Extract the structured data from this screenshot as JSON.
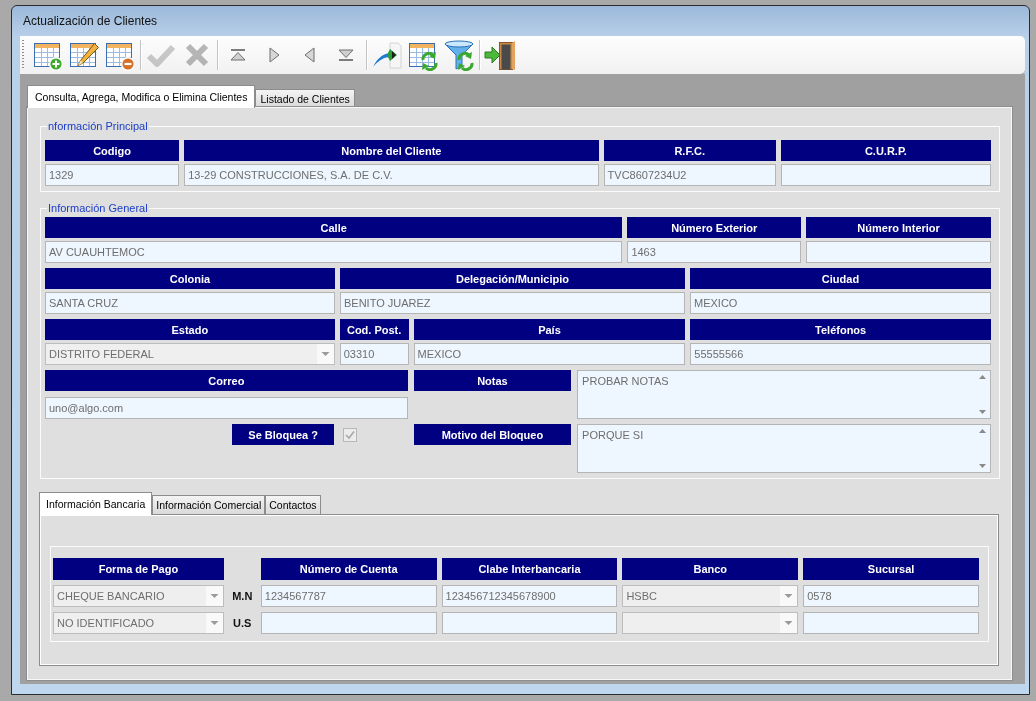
{
  "window": {
    "title": "Actualización de Clientes"
  },
  "toolbar": {
    "groups": [
      {
        "buttons": [
          {
            "kind": "add",
            "disabled": false
          },
          {
            "kind": "edit",
            "disabled": false
          },
          {
            "kind": "delete",
            "disabled": false
          }
        ]
      },
      {
        "buttons": [
          {
            "kind": "accept",
            "disabled": true
          },
          {
            "kind": "cancel",
            "disabled": true
          }
        ]
      },
      {
        "buttons": [
          {
            "kind": "first",
            "disabled": false
          },
          {
            "kind": "next",
            "disabled": false
          },
          {
            "kind": "previous",
            "disabled": false
          },
          {
            "kind": "last",
            "disabled": false
          }
        ]
      },
      {
        "buttons": [
          {
            "kind": "export",
            "disabled": false
          },
          {
            "kind": "refresh",
            "disabled": false
          },
          {
            "kind": "filter",
            "disabled": false
          }
        ]
      },
      {
        "buttons": [
          {
            "kind": "exit",
            "disabled": false
          }
        ]
      }
    ]
  },
  "tabs": [
    {
      "label": "Consulta, Agrega, Modifica o Elimina Clientes",
      "selected": true
    },
    {
      "label": "Listado de Clientes",
      "selected": false
    }
  ],
  "principal": {
    "legend": "nformación Principal",
    "fields": [
      {
        "label": "Codigo",
        "kind": "text",
        "value": "1329"
      },
      {
        "label": "Nombre del Cliente",
        "kind": "text",
        "value": "13-29 CONSTRUCCIONES, S.A. DE C.V."
      },
      {
        "label": "R.F.C.",
        "kind": "text",
        "value": "TVC8607234U2"
      },
      {
        "label": "C.U.R.P.",
        "kind": "text"
      }
    ]
  },
  "general": {
    "legend": "Información General",
    "rows": [
      {
        "fields": [
          {
            "label": "Calle",
            "kind": "text",
            "value": "AV CUAUHTEMOC"
          },
          {
            "label": "Número Exterior",
            "kind": "text",
            "value": "1463"
          },
          {
            "label": "Número Interior",
            "kind": "text"
          }
        ]
      },
      {
        "fields": [
          {
            "label": "Colonia",
            "kind": "text",
            "value": "SANTA CRUZ"
          },
          {
            "label": "Delegación/Municipio",
            "kind": "text",
            "value": "BENITO JUAREZ"
          },
          {
            "label": "Ciudad",
            "kind": "text",
            "value": "MEXICO"
          }
        ]
      },
      {
        "fields": [
          {
            "label": "Estado",
            "kind": "combo",
            "value": "DISTRITO FEDERAL"
          },
          {
            "label": "Cod. Post.",
            "kind": "text",
            "value": "03310"
          },
          {
            "label": "País",
            "kind": "text",
            "value": "MEXICO"
          },
          {
            "label": "Teléfonos",
            "kind": "text",
            "value": "55555566"
          }
        ]
      }
    ],
    "email": {
      "label": "Correo",
      "kind": "text",
      "value": "uno@algo.com"
    },
    "notes": {
      "label": "Notas",
      "kind": "memo",
      "value": "PROBAR NOTAS"
    },
    "blocked": {
      "label": "Se Bloquea ?",
      "checked": true,
      "disabled": true
    },
    "block_reason": {
      "label": "Motivo del Bloqueo",
      "kind": "memo",
      "value": "PORQUE SI"
    }
  },
  "bank_tabs": [
    {
      "label": "Información Bancaria",
      "selected": true
    },
    {
      "label": "Información Comercial",
      "selected": false
    },
    {
      "label": "Contactos",
      "selected": false
    }
  ],
  "bank": {
    "columns": [
      "Forma de Pago",
      "Número de Cuenta",
      "Clabe Interbancaria",
      "Banco",
      "Sucursal"
    ],
    "rows": [
      {
        "currency": "M.N",
        "cells": [
          {
            "kind": "combo",
            "value": "CHEQUE BANCARIO"
          },
          {
            "kind": "text",
            "value": "1234567787"
          },
          {
            "kind": "text",
            "value": "123456712345678900"
          },
          {
            "kind": "combo",
            "value": "HSBC"
          },
          {
            "kind": "text",
            "value": "0578"
          }
        ]
      },
      {
        "currency": "U.S",
        "cells": [
          {
            "kind": "combo",
            "value": "NO IDENTIFICADO"
          },
          {
            "kind": "text"
          },
          {
            "kind": "text"
          },
          {
            "kind": "combo"
          },
          {
            "kind": "text"
          }
        ]
      }
    ]
  }
}
